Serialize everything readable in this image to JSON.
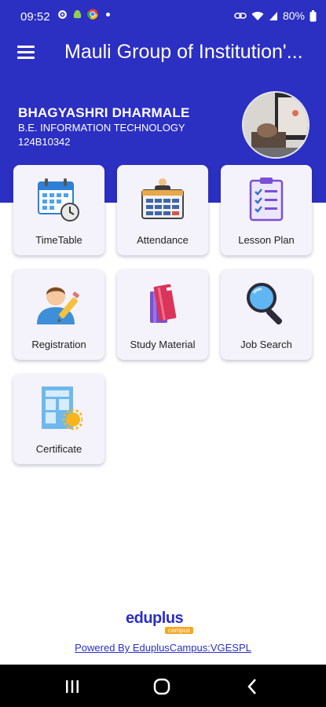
{
  "status_bar": {
    "time": "09:52",
    "battery": "80%"
  },
  "app_bar": {
    "title": "Mauli Group of Institution'..."
  },
  "profile": {
    "name": "BHAGYASHRI DHARMALE",
    "course": "B.E. INFORMATION TECHNOLOGY",
    "id": "124B10342"
  },
  "tiles": [
    {
      "label": "TimeTable",
      "icon": "calendar-clock-icon"
    },
    {
      "label": "Attendance",
      "icon": "attendance-board-icon"
    },
    {
      "label": "Lesson Plan",
      "icon": "checklist-icon"
    },
    {
      "label": "Registration",
      "icon": "user-pencil-icon"
    },
    {
      "label": "Study Material",
      "icon": "books-icon"
    },
    {
      "label": "Job Search",
      "icon": "magnifier-icon"
    },
    {
      "label": "Certificate",
      "icon": "certificate-icon"
    }
  ],
  "footer": {
    "logo_text": "eduplus",
    "logo_tag": "campus",
    "powered_by": "Powered By EduplusCampus:VGESPL"
  },
  "colors": {
    "primary": "#2b2fc2",
    "tile_bg": "#f4f3fb",
    "accent": "#f7a520"
  }
}
